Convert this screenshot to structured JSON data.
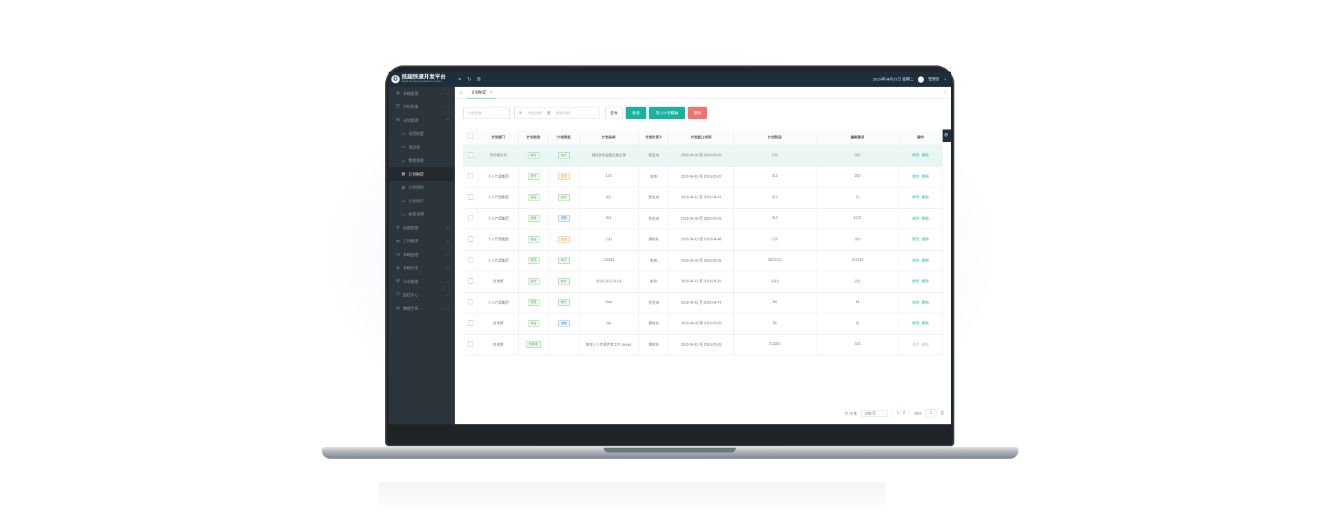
{
  "app": {
    "brand_title": "技超快速开发平台",
    "brand_subtitle": "Rapid development platform for team",
    "logo_letter": "G"
  },
  "topbar": {
    "icons": [
      "menu-icon",
      "refresh-icon",
      "grid-icon"
    ],
    "date_text": "2019年04月29日 星期二",
    "username": "管理员"
  },
  "sidebar": {
    "items": [
      {
        "label": "系统管理",
        "icon": "gear-icon",
        "child": false,
        "active": false,
        "chevron": "⌄"
      },
      {
        "label": "字化权限",
        "icon": "key-icon",
        "child": false,
        "active": false,
        "chevron": "⌄"
      },
      {
        "label": "计划管理",
        "icon": "list-icon",
        "child": false,
        "active": false,
        "chevron": "⌃"
      },
      {
        "label": "流程配置",
        "icon": "monitor-icon",
        "child": true,
        "active": false
      },
      {
        "label": "项目表",
        "icon": "monitor-icon",
        "child": true,
        "active": false
      },
      {
        "label": "数据报表",
        "icon": "monitor-icon",
        "child": true,
        "active": false
      },
      {
        "label": "计划制定",
        "icon": "book-icon",
        "child": true,
        "active": true
      },
      {
        "label": "计划审核",
        "icon": "book-icon",
        "child": true,
        "active": false
      },
      {
        "label": "计划执行",
        "icon": "monitor-icon",
        "child": true,
        "active": false
      },
      {
        "label": "制度说明",
        "icon": "monitor-icon",
        "child": true,
        "active": false
      },
      {
        "label": "权限管理",
        "icon": "pin-icon",
        "child": false,
        "active": false,
        "chevron": "⌄"
      },
      {
        "label": "工作报表",
        "icon": "flow-icon",
        "child": false,
        "active": false,
        "chevron": "⌄"
      },
      {
        "label": "系统管理",
        "icon": "clock-icon",
        "child": false,
        "active": false,
        "chevron": "⌄"
      },
      {
        "label": "系统日志",
        "icon": "gear-icon",
        "child": false,
        "active": false,
        "chevron": "⌄"
      },
      {
        "label": "日志管理",
        "icon": "list-icon",
        "child": false,
        "active": false,
        "chevron": "⌄"
      },
      {
        "label": "监控中心",
        "icon": "shield-icon",
        "child": false,
        "active": false,
        "chevron": "⌄"
      },
      {
        "label": "数据字典",
        "icon": "grid-icon",
        "child": false,
        "active": false,
        "chevron": "⌄"
      }
    ]
  },
  "tabs": {
    "home_icon": "home-icon",
    "active_tab": "计划制定",
    "close": "×",
    "dropdown": "⌄"
  },
  "filters": {
    "name_placeholder": "计划名称",
    "start_placeholder": "开始日期",
    "range_sep": "至",
    "end_placeholder": "结束日期",
    "query_label": "查询",
    "add_label": "新增",
    "import_label": "导入计划模板",
    "delete_label": "删除"
  },
  "table": {
    "headers": [
      "",
      "计划部门",
      "计划状态",
      "计划类型",
      "计划名称",
      "计划负责人",
      "计划起止时间",
      "计划阶段",
      "编制要求",
      "操作"
    ],
    "rows": [
      {
        "dept": "华尔街公司",
        "status": "进行",
        "status_color": "green",
        "type": "执行",
        "type_color": "green",
        "name": "测试发布是否正常上传",
        "owner": "张宝洲",
        "period": "2019-04-30 至 2019-05-09",
        "stage": "123",
        "req": "312",
        "edit": "修改",
        "del": "删除",
        "highlight": true,
        "disabled": false
      },
      {
        "dept": "人人开源集团",
        "status": "进行",
        "status_color": "green",
        "type": "变更",
        "type_color": "orange",
        "name": "123",
        "owner": "赵四",
        "period": "2019-04-18 至 2019-05-07",
        "stage": "213",
        "req": "213",
        "edit": "修改",
        "del": "删除",
        "highlight": false,
        "disabled": false
      },
      {
        "dept": "人人开源集团",
        "status": "完成",
        "status_color": "green",
        "type": "执行",
        "type_color": "green",
        "name": "321",
        "owner": "张宝洲",
        "period": "2019-04-11 至 2019-04-47",
        "stage": "312",
        "req": "31",
        "edit": "修改",
        "del": "删除",
        "highlight": false,
        "disabled": false
      },
      {
        "dept": "人人开源集团",
        "status": "进展",
        "status_color": "green",
        "type": "调整",
        "type_color": "blue",
        "name": "312",
        "owner": "张宝洲",
        "period": "2019-04-30 至 2019-05-09",
        "stage": "312",
        "req": "5123",
        "edit": "修改",
        "del": "删除",
        "highlight": false,
        "disabled": false
      },
      {
        "dept": "人人开源集团",
        "status": "完成",
        "status_color": "green",
        "type": "变更",
        "type_color": "orange",
        "name": "1111",
        "owner": "郑晓东",
        "period": "2019-04-10 至 2019-04-48",
        "stage": "125",
        "req": "312",
        "edit": "修改",
        "del": "删除",
        "highlight": false,
        "disabled": false
      },
      {
        "dept": "人人开源集团",
        "status": "完成",
        "status_color": "green",
        "type": "执行",
        "type_color": "green",
        "name": "123213",
        "owner": "赵四",
        "period": "2019-04-30 至 2019-05-09",
        "stage": "3213123",
        "req": "213312",
        "edit": "修改",
        "del": "删除",
        "highlight": false,
        "disabled": false
      },
      {
        "dept": "技术部",
        "status": "进行",
        "status_color": "green",
        "type": "执行",
        "type_color": "green",
        "name": "312111111111111",
        "owner": "赵四",
        "period": "2019-04-11 至 2019-05-16",
        "stage": "3213",
        "req": "212",
        "edit": "修改",
        "del": "删除",
        "highlight": false,
        "disabled": false
      },
      {
        "dept": "人人开源集团",
        "status": "完成",
        "status_color": "green",
        "type": "执行",
        "type_color": "green",
        "name": "rtew",
        "owner": "张宝洲",
        "period": "2019-04-11 至 2019-04-47",
        "stage": "5d",
        "req": "5d",
        "edit": "修改",
        "del": "删除",
        "highlight": false,
        "disabled": false
      },
      {
        "dept": "技术部",
        "status": "完成",
        "status_color": "green",
        "type": "调整",
        "type_color": "blue",
        "name": "fsd",
        "owner": "郑晓东",
        "period": "2019-04-30 至 2019-05-09",
        "stage": "56",
        "req": "fd",
        "edit": "修改",
        "del": "删除",
        "highlight": false,
        "disabled": false
      },
      {
        "dept": "技术部",
        "status": "待处理",
        "status_color": "green",
        "type": "",
        "type_color": "",
        "name": "制定人人开源开发工作 (temp)",
        "owner": "郑晓东",
        "period": "2019-04-12 至 2019-05-09",
        "stage": "213213",
        "req": "321",
        "edit": "修改",
        "del": "删除",
        "highlight": false,
        "disabled": true
      }
    ]
  },
  "pager": {
    "page_size_prefix": "共 10 条",
    "page_size": "10条/页",
    "prev": "‹",
    "pages": [
      "1",
      "2"
    ],
    "next": "›",
    "goto_label": "前往",
    "goto_value": "1",
    "goto_suffix": "页"
  },
  "colors": {
    "accent": "#19b39d",
    "danger": "#f0736e",
    "topbar": "#1c2f3a",
    "sidebar": "#2b353b"
  }
}
